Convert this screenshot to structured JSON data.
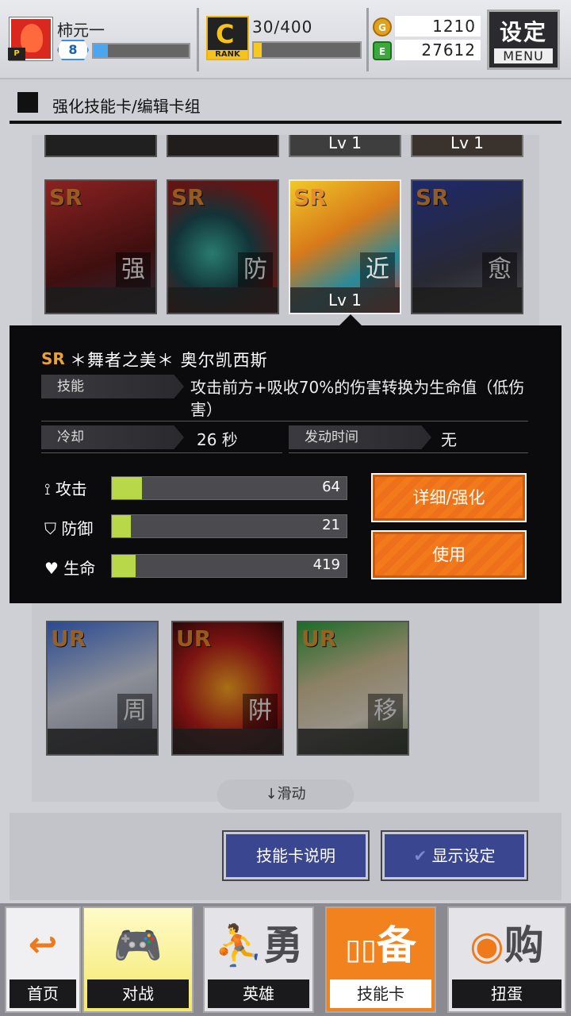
{
  "header": {
    "player_name": "柿元一",
    "player_level": "8",
    "exp_fill": 0.15,
    "rank_letter": "C",
    "rank_label": "RANK",
    "rank_progress": "30/400",
    "rank_fill": 0.075,
    "coin_g": "1210",
    "coin_e": "27612",
    "coin_g_icon": "G",
    "coin_e_icon": "E",
    "settings_label": "设定",
    "menu_label": "MENU"
  },
  "page": {
    "title": "强化技能卡/编辑卡组"
  },
  "cards_top": [
    {
      "rarity": "",
      "level": ""
    },
    {
      "rarity": "",
      "level": ""
    },
    {
      "rarity": "",
      "level": "Lv 1"
    },
    {
      "rarity": "",
      "level": "Lv 1"
    }
  ],
  "cards_row1": [
    {
      "rarity": "SR",
      "type": "强",
      "level": "",
      "color": "#b02a2a"
    },
    {
      "rarity": "SR",
      "type": "防",
      "level": "",
      "color": "#8a1f1f"
    },
    {
      "rarity": "SR",
      "type": "近",
      "level": "Lv 1",
      "color": "#d8b020"
    },
    {
      "rarity": "SR",
      "type": "愈",
      "level": "",
      "color": "#2a3a8a"
    }
  ],
  "detail": {
    "rarity": "SR",
    "name": "＊舞者之美＊ 奥尔凯西斯",
    "skill_label": "技能",
    "skill_text": "攻击前方+吸收70%的伤害转换为生命值（低伤害）",
    "cooldown_label": "冷却",
    "cooldown_value": "26 秒",
    "trigger_label": "发动时间",
    "trigger_value": "无",
    "stats": [
      {
        "label": "攻击",
        "value": "64",
        "fill": 0.13,
        "icon": "sword-icon"
      },
      {
        "label": "防御",
        "value": "21",
        "fill": 0.08,
        "icon": "shield-icon"
      },
      {
        "label": "生命",
        "value": "419",
        "fill": 0.1,
        "icon": "heart-icon"
      }
    ],
    "detail_button": "详细/强化",
    "use_button": "使用"
  },
  "cards_row2": [
    {
      "rarity": "UR",
      "type": "周",
      "color": "#2a4fb0"
    },
    {
      "rarity": "UR",
      "type": "阱",
      "color": "#b01a1a"
    },
    {
      "rarity": "UR",
      "type": "移",
      "color": "#2a8a3a"
    }
  ],
  "scroll_hint": "↓滑动",
  "buttons": {
    "card_help": "技能卡说明",
    "display_settings": "显示设定"
  },
  "nav": [
    {
      "label": "首页",
      "icon": "home-icon"
    },
    {
      "label": "对战",
      "icon": "gamepad-icon"
    },
    {
      "label": "英雄",
      "icon": "hero-icon"
    },
    {
      "label": "技能卡",
      "icon": "card-icon"
    },
    {
      "label": "扭蛋",
      "icon": "gacha-icon"
    }
  ],
  "nav_icons": {
    "hero": "勇",
    "card": "备",
    "gacha": "购"
  }
}
